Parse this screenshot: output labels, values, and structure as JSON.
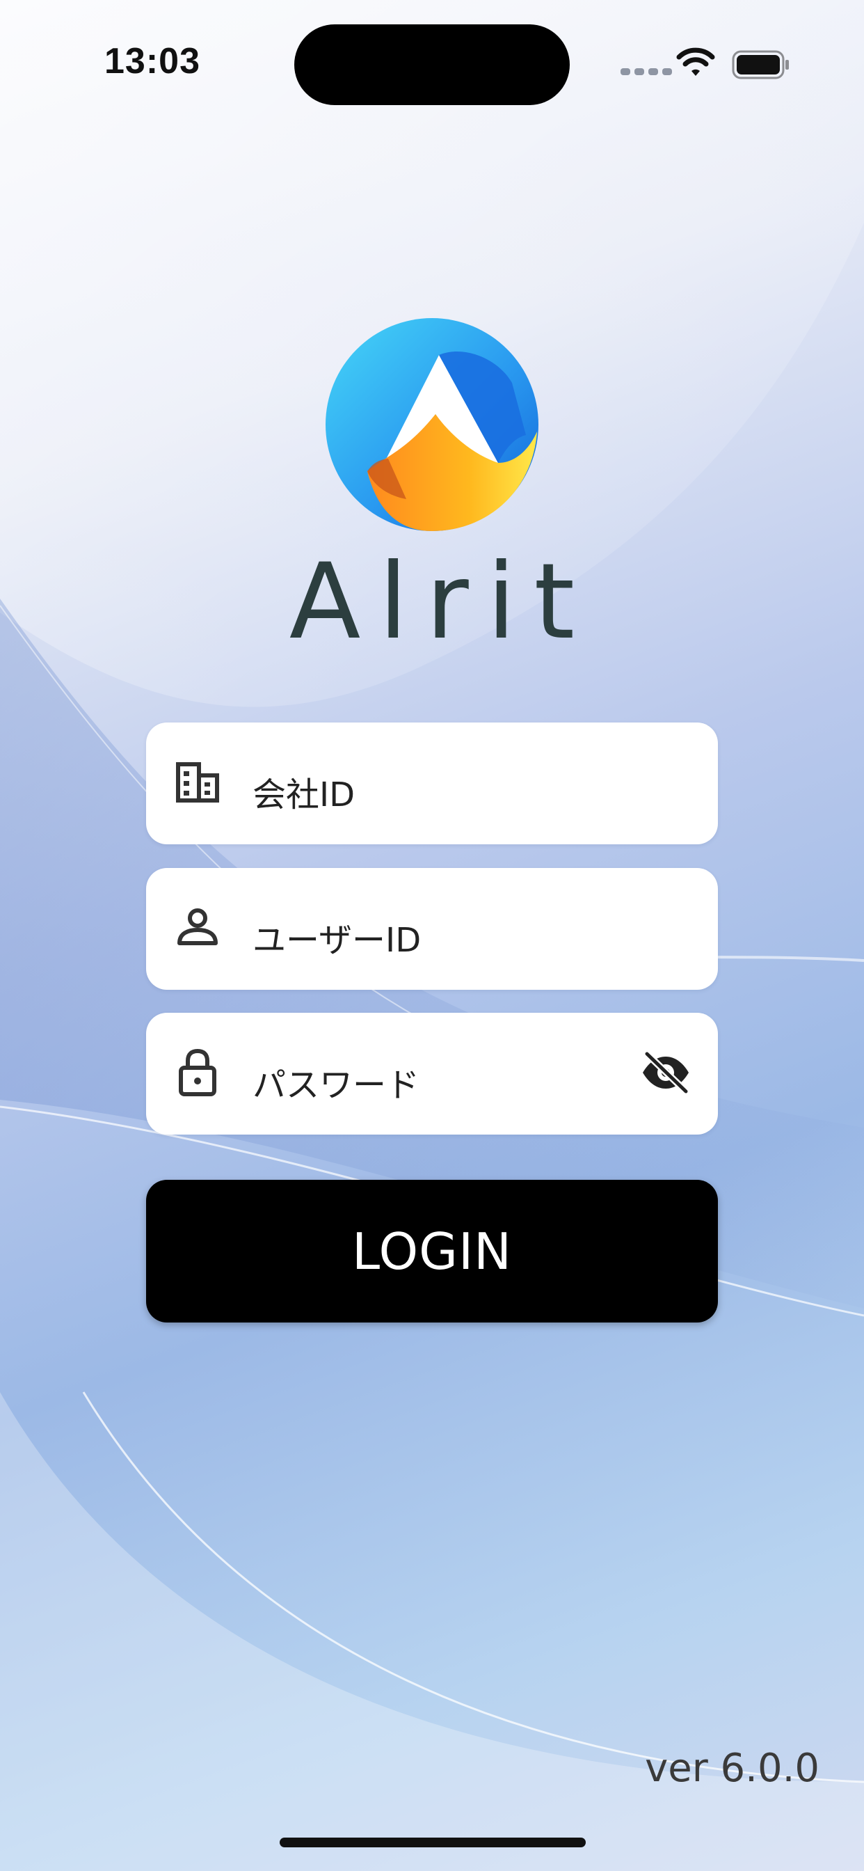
{
  "status_bar": {
    "time": "13:03"
  },
  "brand": {
    "name": "Alrit",
    "logo_colors": [
      "#3ad0f5",
      "#1a7ee8",
      "#ffb21e",
      "#ffe045"
    ]
  },
  "form": {
    "company_id": {
      "placeholder": "会社ID",
      "icon": "building-icon"
    },
    "user_id": {
      "placeholder": "ユーザーID",
      "icon": "person-icon"
    },
    "password": {
      "placeholder": "パスワード",
      "icon": "lock-icon",
      "toggle_icon": "eye-off-icon"
    },
    "login_label": "LOGIN"
  },
  "footer": {
    "version": "ver 6.0.0"
  }
}
